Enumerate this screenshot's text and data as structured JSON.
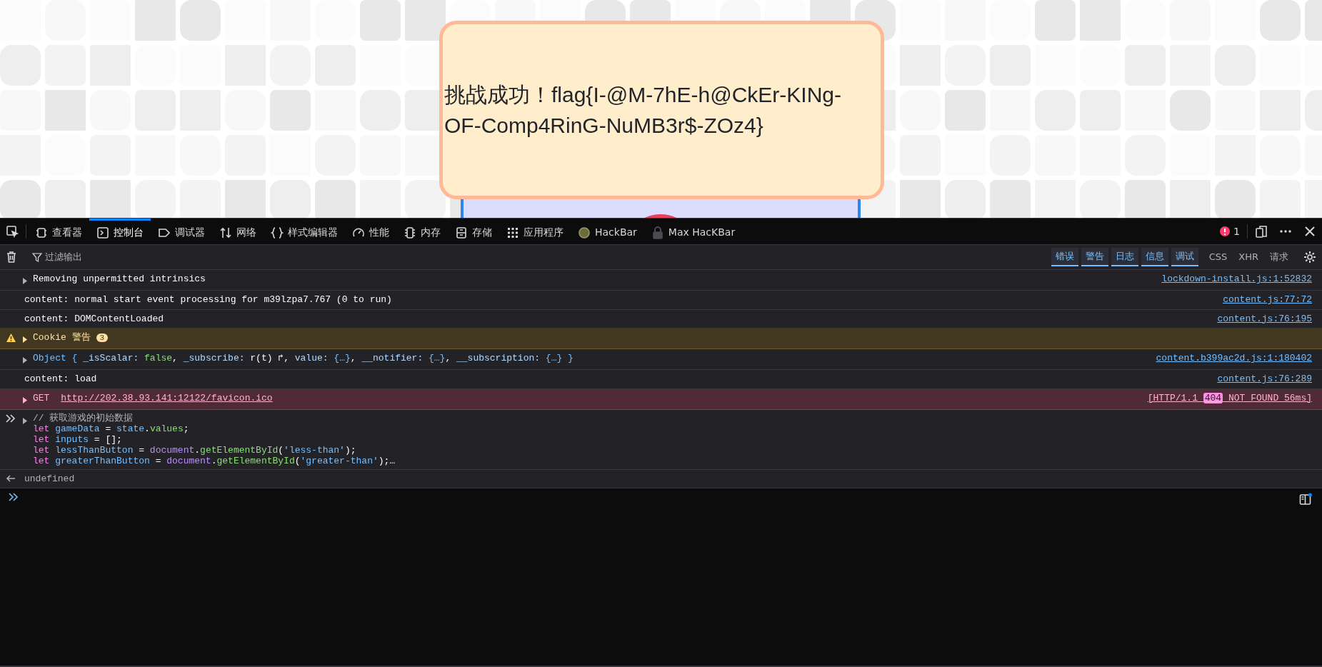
{
  "page": {
    "message": "挑战成功！flag{I-@M-7hE-h@CkEr-KINg-OF-Comp4RinG-NuMB3r$-ZOz4}"
  },
  "devtools": {
    "tabs": [
      {
        "kind": "inspector",
        "label": "查看器",
        "selected": false
      },
      {
        "kind": "console",
        "label": "控制台",
        "selected": true
      },
      {
        "kind": "debugger",
        "label": "调试器",
        "selected": false
      },
      {
        "kind": "network",
        "label": "网络",
        "selected": false
      },
      {
        "kind": "style",
        "label": "样式编辑器",
        "selected": false
      },
      {
        "kind": "performance",
        "label": "性能",
        "selected": false
      },
      {
        "kind": "memory",
        "label": "内存",
        "selected": false
      },
      {
        "kind": "storage",
        "label": "存储",
        "selected": false
      },
      {
        "kind": "application",
        "label": "应用程序",
        "selected": false
      },
      {
        "kind": "hackbar",
        "label": "HackBar",
        "selected": false
      },
      {
        "kind": "lock",
        "label": "Max HacKBar",
        "selected": false
      }
    ],
    "error_count": "1",
    "filter": {
      "placeholder": "过滤输出"
    },
    "levels": [
      {
        "label": "错误",
        "selected": true
      },
      {
        "label": "警告",
        "selected": true
      },
      {
        "label": "日志",
        "selected": true
      },
      {
        "label": "信息",
        "selected": true
      },
      {
        "label": "调试",
        "selected": true
      }
    ],
    "request_filters": [
      {
        "label": "CSS",
        "selected": false
      },
      {
        "label": "XHR",
        "selected": false
      },
      {
        "label": "请求",
        "selected": false
      }
    ],
    "messages": [
      {
        "kind": "group",
        "expanded": false,
        "text": "Removing unpermitted intrinsics",
        "source": "lockdown-install.js:1:52832"
      },
      {
        "kind": "log",
        "text": "content: normal start event processing for m39lzpa7.767 (0 to run)",
        "source": "content.js:77:72"
      },
      {
        "kind": "log",
        "text": "content: DOMContentLoaded",
        "source": "content.js:76:195"
      },
      {
        "kind": "warning",
        "expanded": false,
        "text": "Cookie 警告",
        "count": "3"
      },
      {
        "kind": "object",
        "expanded": false,
        "tokens": [
          {
            "kind": "type",
            "t": "Object { "
          },
          {
            "kind": "key",
            "t": "_isScalar: "
          },
          {
            "kind": "bool",
            "t": "false"
          },
          {
            "kind": "punct",
            "t": ", "
          },
          {
            "kind": "key",
            "t": "_subscribe: "
          },
          {
            "kind": "fn",
            "t": "r(t) ↱"
          },
          {
            "kind": "punct",
            "t": ", "
          },
          {
            "kind": "key",
            "t": "value: "
          },
          {
            "kind": "obj",
            "t": "{…}"
          },
          {
            "kind": "punct",
            "t": ", "
          },
          {
            "kind": "key",
            "t": "__notifier: "
          },
          {
            "kind": "obj",
            "t": "{…}"
          },
          {
            "kind": "punct",
            "t": ", "
          },
          {
            "kind": "key",
            "t": "__subscription: "
          },
          {
            "kind": "obj",
            "t": "{…}"
          },
          {
            "kind": "type",
            "t": " }"
          }
        ],
        "source": "content.b399ac2d.js:1:180402"
      },
      {
        "kind": "log",
        "text": "content: load",
        "source": "content.js:76:289"
      },
      {
        "kind": "error",
        "expanded": false,
        "method": "GET",
        "url": "http://202.38.93.141:12122/favicon.ico",
        "status": {
          "prefix": "[HTTP/1.1",
          "code": "404",
          "suffix": "NOT FOUND 56ms]"
        }
      },
      {
        "kind": "input",
        "expanded": false,
        "lines": [
          [
            {
              "kind": "comment",
              "t": "// 获取游戏的初始数据"
            }
          ],
          [
            {
              "kind": "kw",
              "t": "let "
            },
            {
              "kind": "var",
              "t": "gameData"
            },
            {
              "kind": "plain",
              "t": " = "
            },
            {
              "kind": "var",
              "t": "state"
            },
            {
              "kind": "plain",
              "t": "."
            },
            {
              "kind": "prop",
              "t": "values"
            },
            {
              "kind": "plain",
              "t": ";"
            }
          ],
          [
            {
              "kind": "kw",
              "t": "let "
            },
            {
              "kind": "var",
              "t": "inputs"
            },
            {
              "kind": "plain",
              "t": " = [];"
            }
          ],
          [
            {
              "kind": "kw",
              "t": "let "
            },
            {
              "kind": "var",
              "t": "lessThanButton"
            },
            {
              "kind": "plain",
              "t": " = "
            },
            {
              "kind": "global",
              "t": "document"
            },
            {
              "kind": "plain",
              "t": "."
            },
            {
              "kind": "prop",
              "t": "getElementById"
            },
            {
              "kind": "plain",
              "t": "("
            },
            {
              "kind": "str",
              "t": "'less-than'"
            },
            {
              "kind": "plain",
              "t": ");"
            }
          ],
          [
            {
              "kind": "kw",
              "t": "let "
            },
            {
              "kind": "var",
              "t": "greaterThanButton"
            },
            {
              "kind": "plain",
              "t": " = "
            },
            {
              "kind": "global",
              "t": "document"
            },
            {
              "kind": "plain",
              "t": "."
            },
            {
              "kind": "prop",
              "t": "getElementById"
            },
            {
              "kind": "plain",
              "t": "("
            },
            {
              "kind": "str",
              "t": "'greater-than'"
            },
            {
              "kind": "plain",
              "t": ");…"
            }
          ]
        ]
      },
      {
        "kind": "result",
        "text": "undefined"
      }
    ]
  }
}
